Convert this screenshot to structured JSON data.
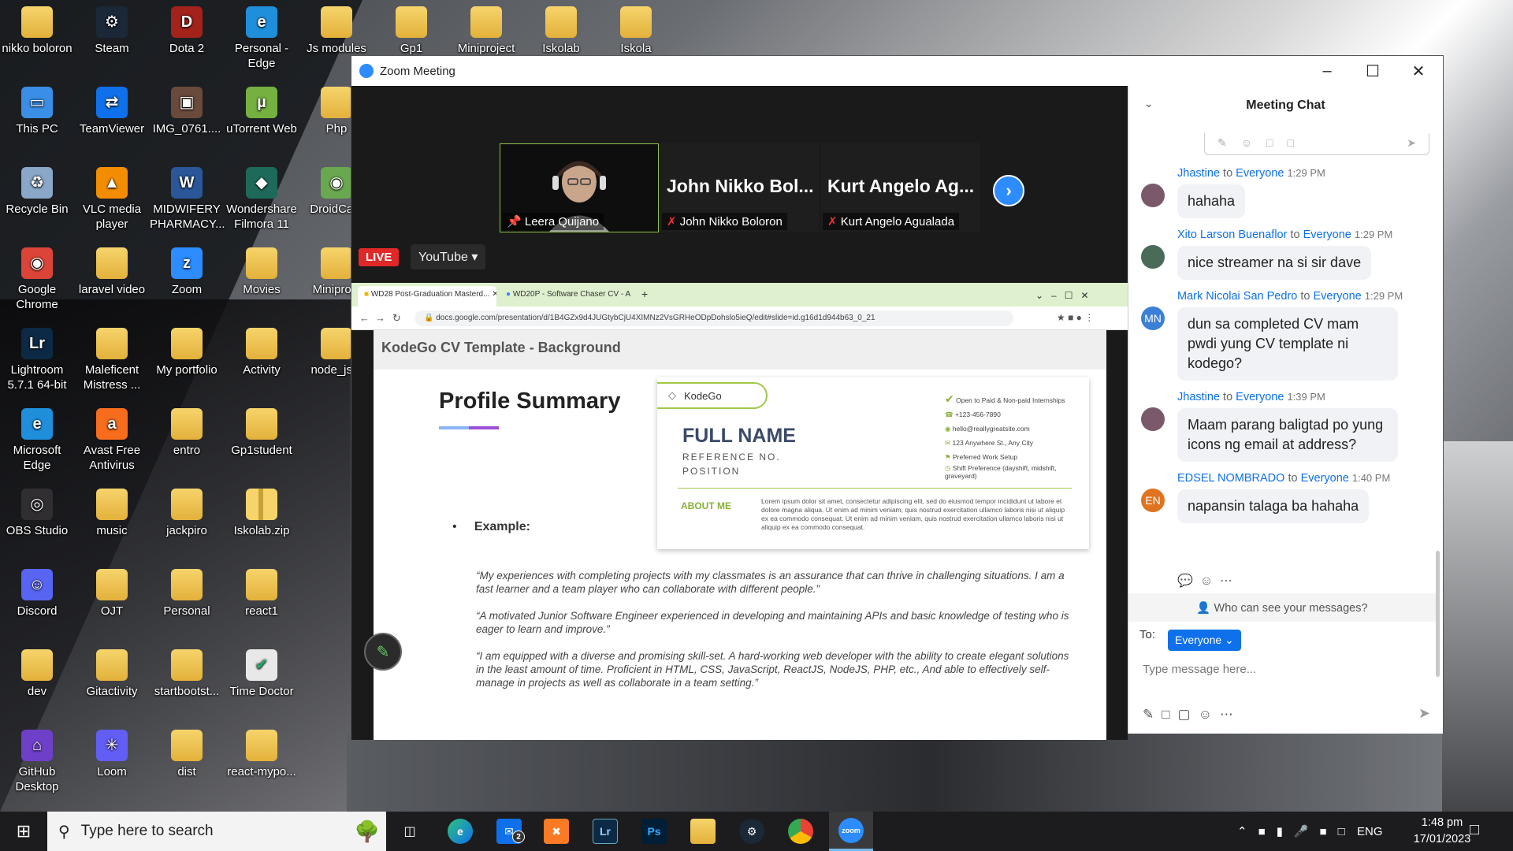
{
  "desktop_icons": [
    {
      "label": "nikko boloron",
      "icon": "folder-icon"
    },
    {
      "label": "Steam",
      "icon": "steam-icon"
    },
    {
      "label": "Dota 2",
      "icon": "dota-icon"
    },
    {
      "label": "Personal - Edge",
      "icon": "edge-icon"
    },
    {
      "label": "Js modules",
      "icon": "folder-icon"
    },
    {
      "label": "Gp1",
      "icon": "folder-icon"
    },
    {
      "label": "Miniproject",
      "icon": "folder-icon"
    },
    {
      "label": "Iskolab",
      "icon": "folder-icon"
    },
    {
      "label": "Iskola",
      "icon": "folder-icon"
    },
    {
      "label": "This PC",
      "icon": "monitor-icon"
    },
    {
      "label": "TeamViewer",
      "icon": "teamviewer-icon"
    },
    {
      "label": "IMG_0761....",
      "icon": "image-icon"
    },
    {
      "label": "uTorrent Web",
      "icon": "utorrent-icon"
    },
    {
      "label": "Php",
      "icon": "folder-icon"
    },
    {
      "label": "Recycle Bin",
      "icon": "recycle-bin-icon"
    },
    {
      "label": "VLC media player",
      "icon": "vlc-icon"
    },
    {
      "label": "MIDWIFERY PHARMACY....",
      "icon": "word-doc-icon"
    },
    {
      "label": "Wondershare Filmora 11",
      "icon": "filmora-icon"
    },
    {
      "label": "DroidCam",
      "icon": "droidcam-icon"
    },
    {
      "label": "Google Chrome",
      "icon": "chrome-icon"
    },
    {
      "label": "laravel video",
      "icon": "folder-icon"
    },
    {
      "label": "Zoom",
      "icon": "zoom-icon"
    },
    {
      "label": "Movies",
      "icon": "folder-icon"
    },
    {
      "label": "Miniproje",
      "icon": "folder-icon"
    },
    {
      "label": "Lightroom 5.7.1 64-bit",
      "icon": "lightroom-icon"
    },
    {
      "label": "Maleficent Mistress ...",
      "icon": "folder-icon"
    },
    {
      "label": "My portfolio",
      "icon": "folder-icon"
    },
    {
      "label": "Activity",
      "icon": "folder-icon"
    },
    {
      "label": "node_js...",
      "icon": "folder-icon"
    },
    {
      "label": "Microsoft Edge",
      "icon": "edge-icon"
    },
    {
      "label": "Avast Free Antivirus",
      "icon": "avast-icon"
    },
    {
      "label": "entro",
      "icon": "folder-icon"
    },
    {
      "label": "Gp1student",
      "icon": "folder-icon"
    },
    {
      "label": "OBS Studio",
      "icon": "obs-icon"
    },
    {
      "label": "music",
      "icon": "folder-icon"
    },
    {
      "label": "jackpiro",
      "icon": "folder-icon"
    },
    {
      "label": "Iskolab.zip",
      "icon": "zip-icon"
    },
    {
      "label": "Discord",
      "icon": "discord-icon"
    },
    {
      "label": "OJT",
      "icon": "folder-icon"
    },
    {
      "label": "Personal",
      "icon": "folder-icon"
    },
    {
      "label": "react1",
      "icon": "folder-icon"
    },
    {
      "label": "dev",
      "icon": "folder-icon"
    },
    {
      "label": "Gitactivity",
      "icon": "folder-icon"
    },
    {
      "label": "startbootst...",
      "icon": "folder-icon"
    },
    {
      "label": "Time Doctor",
      "icon": "timedoctor-icon"
    },
    {
      "label": "GitHub Desktop",
      "icon": "github-icon"
    },
    {
      "label": "Loom",
      "icon": "loom-icon"
    },
    {
      "label": "dist",
      "icon": "folder-icon"
    },
    {
      "label": "react-mypo...",
      "icon": "folder-icon"
    }
  ],
  "zoom": {
    "title": "Zoom Meeting",
    "participants": [
      {
        "big_name": "",
        "name": "Leera Quijano"
      },
      {
        "big_name": "John Nikko Bol...",
        "name": "John Nikko Boloron"
      },
      {
        "big_name": "Kurt Angelo Ag...",
        "name": "Kurt Angelo Agualada"
      }
    ],
    "live_label": "LIVE",
    "stream_target": "YouTube",
    "browser": {
      "tab1": "WD28 Post-Graduation Masterd...",
      "tab2": "WD20P - Software Chaser CV - A",
      "url": "docs.google.com/presentation/d/1B4GZx9d4JUGtybCjU4XIMNz2VsGRHeODpDohslo5ieQ/edit#slide=id.g16d1d944b63_0_21"
    },
    "slide": {
      "header": "KodeGo CV Template - Background",
      "title": "Profile Summary",
      "example_label": "Example:",
      "cv": {
        "logo": "KodeGo",
        "full_name": "FULL NAME",
        "reference": "REFERENCE NO.",
        "position": "POSITION",
        "about_label": "ABOUT ME",
        "lorem": "Lorem ipsum dolor sit amet, consectetur adipiscing elit, sed do eiusmod tempor incididunt ut labore et dolore magna aliqua. Ut enim ad minim veniam, quis nostrud exercitation ullamco laboris nisi ut aliquip ex ea commodo consequat. Ut enim ad minim veniam, quis nostrud exercitation ullamco laboris nisi ut aliquip ex ea commodo consequat.",
        "contacts": [
          "Open to Paid & Non-paid Internships",
          "+123-456-7890",
          "hello@reallygreatsite.com",
          "123 Anywhere St., Any City",
          "Preferred Work Setup",
          "Shift Preference (dayshift, midshift, graveyard)"
        ]
      },
      "quotes": [
        "“My experiences with completing projects with my classmates is an assurance that can thrive in challenging situations. I am a fast learner and a team player who can collaborate with different people.”",
        "“A motivated Junior Software Engineer experienced in developing and maintaining APIs and basic knowledge of testing who is eager to learn and improve.”",
        "“I am equipped with a diverse and promising skill-set. A hard-working web developer with the  ability to create elegant solutions in the least amount of time. Proficient in  HTML, CSS, JavaScript, ReactJS, NodeJS, PHP, etc., And able to effectively self-manage in projects as well as collaborate in a team setting.”"
      ]
    }
  },
  "chat": {
    "title": "Meeting Chat",
    "to_word": "to",
    "messages": [
      {
        "sender": "Jhastine",
        "to": "Everyone",
        "time": "1:29 PM",
        "text": "hahaha",
        "avatar": "",
        "avatar_color": "#7a5a6a"
      },
      {
        "sender": "Xito Larson Buenaflor",
        "to": "Everyone",
        "time": "1:29 PM",
        "text": "nice streamer na si sir dave",
        "avatar": "",
        "avatar_color": "#4a6a5a"
      },
      {
        "sender": "Mark Nicolai San Pedro",
        "to": "Everyone",
        "time": "1:29 PM",
        "text": "dun sa completed CV mam pwdi yung CV template ni kodego?",
        "avatar": "MN",
        "avatar_color": "#3b7fd6"
      },
      {
        "sender": "Jhastine",
        "to": "Everyone",
        "time": "1:39 PM",
        "text": "Maam parang baligtad po yung icons ng email at address?",
        "avatar": "",
        "avatar_color": "#7a5a6a"
      },
      {
        "sender": "EDSEL NOMBRADO",
        "to": "Everyone",
        "time": "1:40 PM",
        "text": "napansin talaga ba hahaha",
        "avatar": "EN",
        "avatar_color": "#e0731f"
      }
    ],
    "who_can_see": "Who can see your messages?",
    "to_label": "To:",
    "recipient": "Everyone",
    "input_placeholder": "Type message here..."
  },
  "taskbar": {
    "search_placeholder": "Type here to search",
    "apps": [
      "task-view",
      "edge",
      "mail",
      "xampp",
      "lightroom",
      "photoshop",
      "file-explorer",
      "steam",
      "chrome",
      "zoom"
    ],
    "mail_badge": "2",
    "language": "ENG",
    "time": "1:48 pm",
    "date": "17/01/2023"
  }
}
